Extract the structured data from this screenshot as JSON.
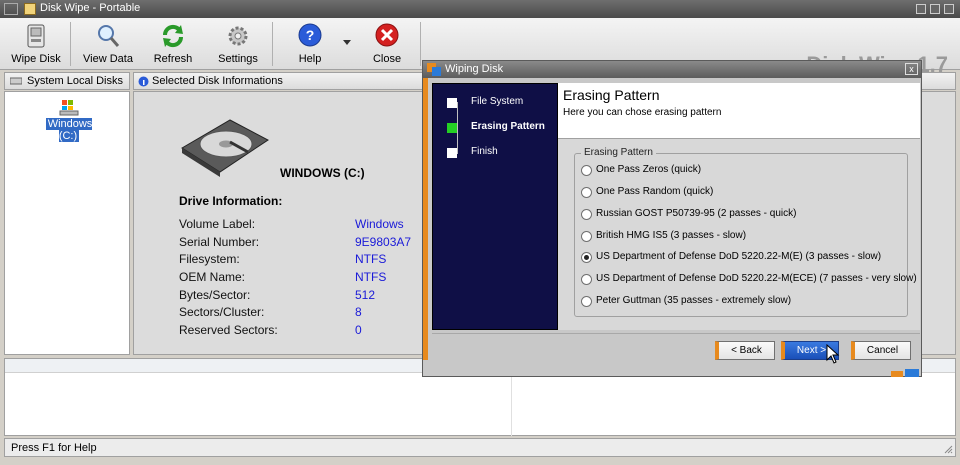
{
  "window": {
    "title": "Disk Wipe  - Portable"
  },
  "toolbar": {
    "wipe_disk": "Wipe Disk",
    "view_data": "View Data",
    "refresh": "Refresh",
    "settings": "Settings",
    "help": "Help",
    "close": "Close",
    "brand": "Disk Wipe 1.7"
  },
  "left_panel": {
    "header": "System Local Disks",
    "drives": [
      {
        "label": "Windows (C:)"
      }
    ]
  },
  "right_panel": {
    "header": "Selected Disk Informations",
    "volume_title": "WINDOWS  (C:)",
    "drive_info_title": "Drive Information:",
    "rows": [
      {
        "key": "Volume Label:",
        "value": "Windows"
      },
      {
        "key": "Serial Number:",
        "value": "9E9803A7"
      },
      {
        "key": "Filesystem:",
        "value": "NTFS"
      },
      {
        "key": "OEM Name:",
        "value": "NTFS"
      },
      {
        "key": "Bytes/Sector:",
        "value": "512"
      },
      {
        "key": "Sectors/Cluster:",
        "value": "8"
      },
      {
        "key": "Reserved Sectors:",
        "value": "0"
      }
    ]
  },
  "statusbar": {
    "text": "Press F1 for Help"
  },
  "dialog": {
    "title": "Wiping Disk",
    "close_glyph": "x",
    "steps": [
      {
        "label": "File System",
        "active": false
      },
      {
        "label": "Erasing Pattern",
        "active": true
      },
      {
        "label": "Finish",
        "active": false
      }
    ],
    "header_title": "Erasing Pattern",
    "header_subtitle": "Here you can chose erasing pattern",
    "group_label": "Erasing Pattern",
    "options": [
      {
        "label": "One Pass Zeros (quick)",
        "selected": false
      },
      {
        "label": "One Pass Random (quick)",
        "selected": false
      },
      {
        "label": "Russian GOST P50739-95 (2 passes - quick)",
        "selected": false
      },
      {
        "label": "British HMG IS5 (3 passes - slow)",
        "selected": false
      },
      {
        "label": "US Department of Defense DoD 5220.22-M(E) (3 passes - slow)",
        "selected": true
      },
      {
        "label": "US Department of Defense DoD 5220.22-M(ECE) (7 passes - very slow)",
        "selected": false
      },
      {
        "label": "Peter Guttman (35 passes - extremely slow)",
        "selected": false
      }
    ],
    "buttons": {
      "back": "< Back",
      "next": "Next >",
      "cancel": "Cancel"
    }
  },
  "colors": {
    "accent_orange": "#e78a1e",
    "wizard_panel": "#0f0f46",
    "value_blue": "#1a1ad8"
  }
}
